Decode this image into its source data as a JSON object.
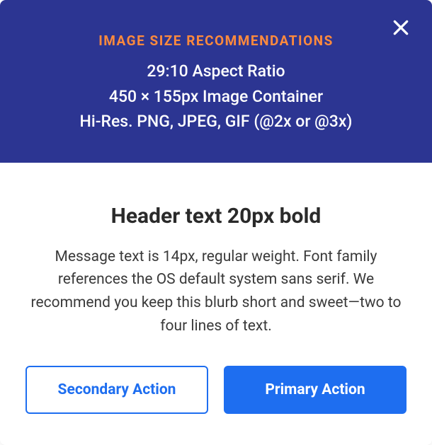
{
  "banner": {
    "heading": "IMAGE SIZE RECOMMENDATIONS",
    "line1": "29:10 Aspect Ratio",
    "line2": "450 × 155px Image Container",
    "line3": "Hi-Res. PNG, JPEG, GIF (@2x or @3x)"
  },
  "body": {
    "header": "Header text 20px bold",
    "message": "Message text is 14px, regular weight. Font family references the OS default system sans serif. We recommend you keep this blurb short and sweet—two to four lines of text."
  },
  "buttons": {
    "secondary": "Secondary Action",
    "primary": "Primary Action"
  },
  "colors": {
    "banner_bg": "#2c3592",
    "accent_orange": "#ff8a3d",
    "primary_blue": "#1e6ef0"
  }
}
